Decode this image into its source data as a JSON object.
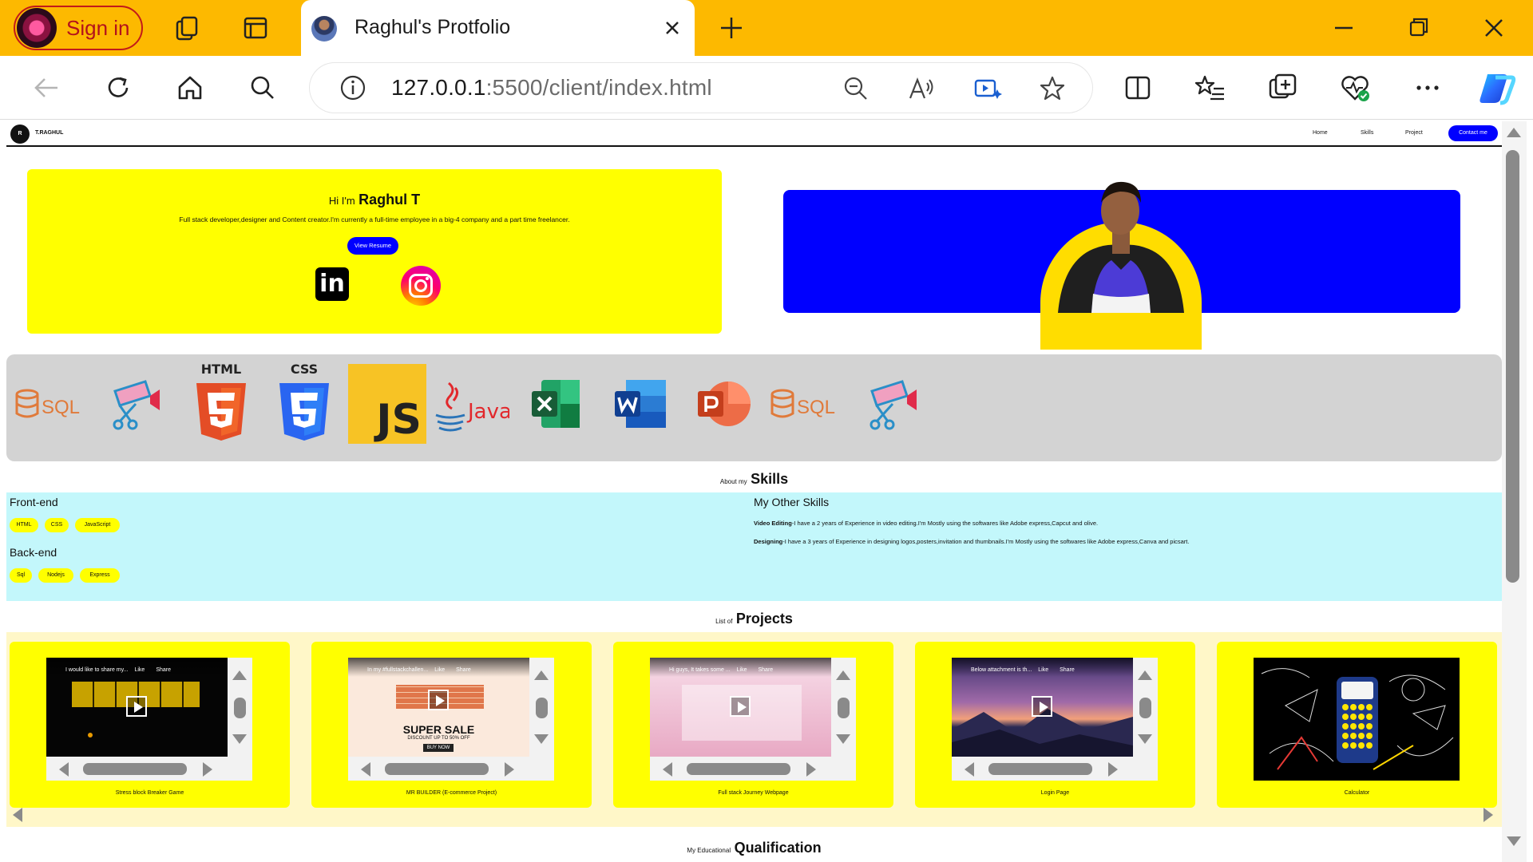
{
  "browser": {
    "signin_label": "Sign in",
    "tab_title": "Raghul's Protfolio",
    "url_host": "127.0.0.1",
    "url_path": ":5500/client/index.html",
    "accent_color": "#fdb900"
  },
  "site": {
    "logo_letter": "R",
    "logo_text": "T.RAGHUL",
    "nav": [
      "Home",
      "Skills",
      "Project"
    ],
    "contact_label": "Contact me"
  },
  "hero": {
    "hi": "Hi I'm",
    "name": "Raghul T",
    "description": "Full stack developer,designer and Content creator.I'm currently a full-time employee in a big-4 company and a part time freelancer.",
    "resume_label": "View Resume",
    "linkedin_glyph": "in",
    "card_color": "#ffff00",
    "banner_color": "#0000ff"
  },
  "skill_strip": {
    "items": [
      "sql-icon",
      "video-edit-icon",
      "html5-icon",
      "css3-icon",
      "javascript-icon",
      "java-icon",
      "excel-icon",
      "word-icon",
      "powerpoint-icon",
      "sql-icon",
      "video-edit-icon"
    ],
    "html_label": "HTML",
    "css_label": "CSS",
    "js_label": "JS",
    "java_label": "Java",
    "sql_label": "SQL"
  },
  "about": {
    "small": "About my",
    "big": "Skills",
    "frontend_title": "Front-end",
    "frontend": [
      "HTML",
      "CSS",
      "JavaScript"
    ],
    "backend_title": "Back-end",
    "backend": [
      "Sql",
      "Nodejs",
      "Express"
    ],
    "other_title": "My Other Skills",
    "video_label": "Video Editing",
    "video_text": "-I have a 2 years of Experience in video editing.I'm  Mostly using the softwares like Adobe express,Capcut and olive.",
    "design_label": "Designing",
    "design_text": "-I have a 3 years of Experience in designing logos,posters,invitation and thumbnails.I'm  Mostly using the softwares like Adobe express,Canva and picsart."
  },
  "projects": {
    "small": "List of",
    "big": "Projects",
    "items": [
      {
        "title": "Stress block Breaker Game",
        "caption": "I would like to share my..."
      },
      {
        "title": "MR BUILDER (E-commerce Project)",
        "caption": "In my #fullstackchallen..."
      },
      {
        "title": "Full stack Journey Webpage",
        "caption": "Hi guys, It takes some ..."
      },
      {
        "title": "Login Page",
        "caption": "Below attachment is th..."
      },
      {
        "title": "Calculator",
        "caption": ""
      }
    ],
    "like_label": "Like",
    "share_label": "Share",
    "sale_label": "SUPER SALE",
    "sale_sub": "DISCOUNT UP TO 50% OFF",
    "buy_label": "BUY NOW"
  },
  "education": {
    "small": "My Educational",
    "big": "Qualification"
  }
}
